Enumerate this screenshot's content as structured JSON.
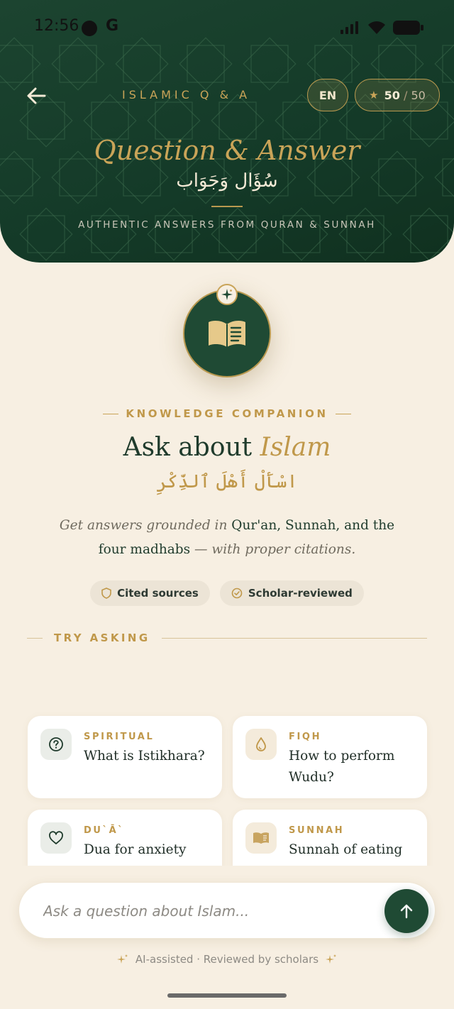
{
  "status_bar": {
    "time": "12:56",
    "app_letter": "G"
  },
  "header": {
    "app_label": "ISLAMIC Q & A",
    "language": "EN",
    "stars": {
      "current": "50",
      "separator": "/",
      "max": "50"
    },
    "title": "Question & Answer",
    "arabic_title": "سُؤَال وَجَوَاب",
    "subtitle": "AUTHENTIC ANSWERS FROM QURAN & SUNNAH"
  },
  "intro": {
    "eyebrow": "KNOWLEDGE COMPANION",
    "title_main": "Ask about ",
    "title_accent": "Islam",
    "arabic_verse": "اسْأَلْ أَهْلَ ٱلذِّكْرِ",
    "desc_part1": "Get answers grounded in ",
    "desc_strong": "Qur'an, Sunnah, and the four madhabs",
    "desc_part2": " — with proper citations."
  },
  "chips": [
    {
      "label": "Cited sources",
      "icon": "shield-icon"
    },
    {
      "label": "Scholar-reviewed",
      "icon": "check-circle-icon"
    }
  ],
  "try_asking_label": "TRY ASKING",
  "suggestions": [
    {
      "category": "SPIRITUAL",
      "question": "What is Istikhara?",
      "icon": "question-circle-icon"
    },
    {
      "category": "FIQH",
      "question": "How to perform Wudu?",
      "icon": "water-drop-icon"
    },
    {
      "category": "DU`Ā`",
      "question": "Dua for anxiety",
      "icon": "heart-icon"
    },
    {
      "category": "SUNNAH",
      "question": "Sunnah of eating",
      "icon": "book-icon"
    }
  ],
  "input": {
    "placeholder": "Ask a question about Islam..."
  },
  "footer_note": "AI-assisted · Reviewed by scholars",
  "colors": {
    "primary_green": "#1f4a34",
    "gold": "#c9a458",
    "background": "#f7efe2"
  }
}
